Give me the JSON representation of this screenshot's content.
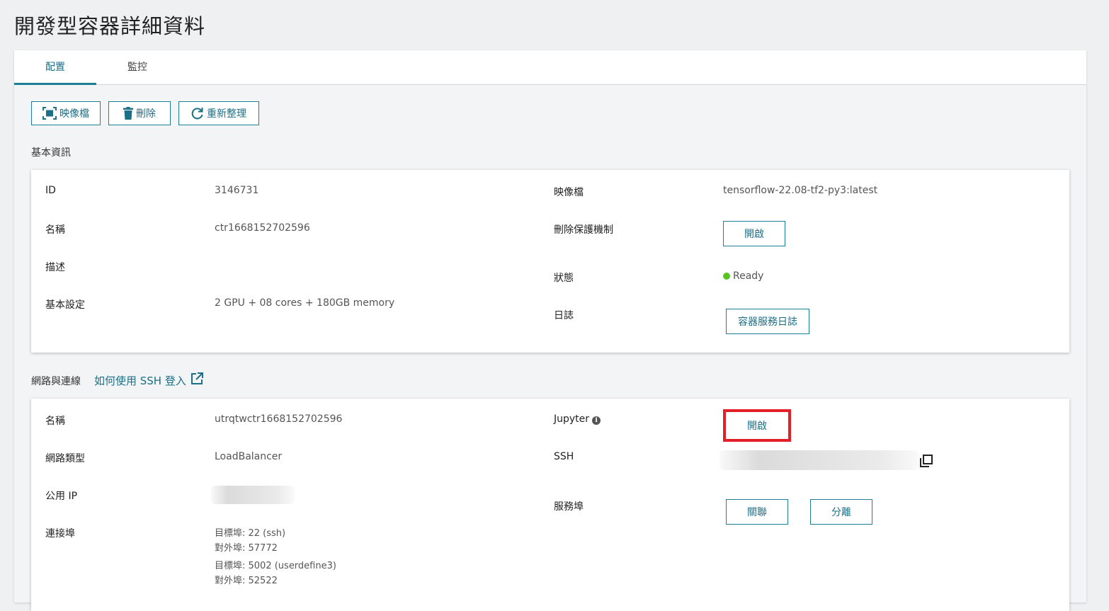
{
  "page": {
    "title": "開發型容器詳細資料"
  },
  "tabs": [
    {
      "label": "配置",
      "active": true
    },
    {
      "label": "監控",
      "active": false
    }
  ],
  "toolbar": {
    "image_label": "映像檔",
    "delete_label": "刪除",
    "refresh_label": "重新整理"
  },
  "basic": {
    "section_title": "基本資訊",
    "id_label": "ID",
    "id_value": "3146731",
    "name_label": "名稱",
    "name_value": "ctr1668152702596",
    "desc_label": "描述",
    "desc_value": "",
    "config_label": "基本設定",
    "config_value": "2 GPU + 08 cores + 180GB memory",
    "image_label": "映像檔",
    "image_value": "tensorflow-22.08-tf2-py3:latest",
    "delete_protect_label": "刪除保護機制",
    "delete_protect_button": "開啟",
    "status_label": "狀態",
    "status_value": "Ready",
    "log_label": "日誌",
    "log_button": "容器服務日誌"
  },
  "network": {
    "section_title": "網路與連線",
    "ssh_help_link": "如何使用 SSH 登入",
    "name_label": "名稱",
    "name_value": "utrqtwctr1668152702596",
    "type_label": "網路類型",
    "type_value": "LoadBalancer",
    "ip_label": "公用 IP",
    "port_label": "連接埠",
    "ports": [
      {
        "target": "目標埠: 22 (ssh)",
        "external": "對外埠: 57772"
      },
      {
        "target": "目標埠: 5002 (userdefine3)",
        "external": "對外埠: 52522"
      }
    ],
    "jupyter_label": "Jupyter",
    "jupyter_button": "開啟",
    "ssh_label": "SSH",
    "service_port_label": "服務埠",
    "associate_button": "關聯",
    "disassociate_button": "分離"
  },
  "colors": {
    "accent": "#1b7f95",
    "highlight": "#e3202a",
    "status_ready": "#58c322"
  }
}
